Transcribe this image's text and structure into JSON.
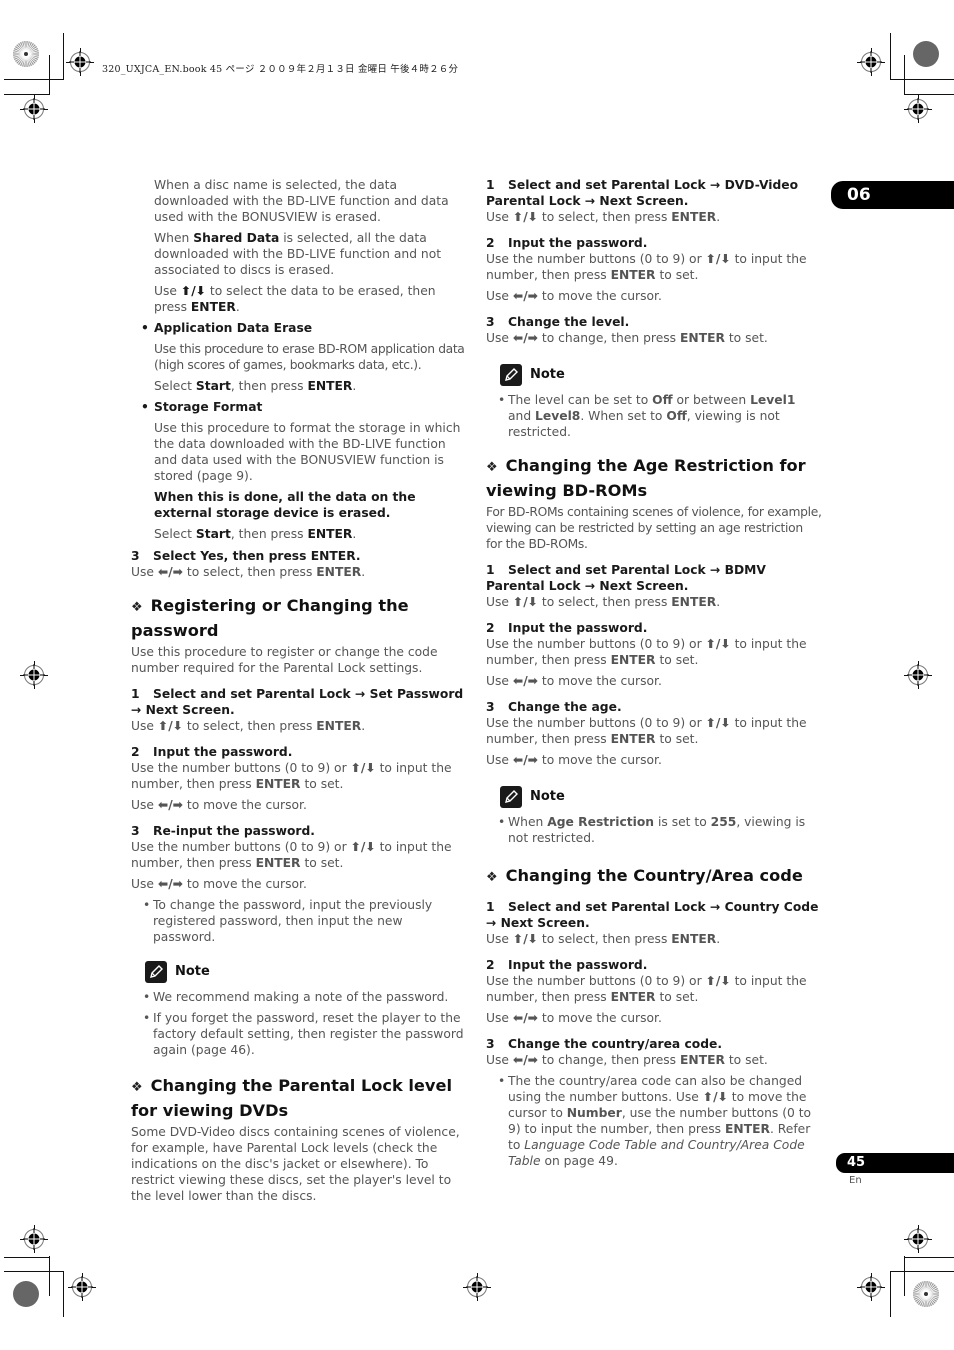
{
  "header": {
    "file_info": "320_UXJCA_EN.book  45 ページ  ２００９年２月１３日  金曜日  午後４時２６分"
  },
  "chapter_tab": "06",
  "footer": {
    "page_number": "45",
    "language": "En"
  },
  "left_column": {
    "intro_paragraphs": [
      [
        {
          "t": "When a disc name is selected, the data downloaded with the BD-LIVE function and data used with the BONUSVIEW is erased."
        }
      ],
      [
        {
          "t": "When "
        },
        {
          "t": "Shared Data",
          "b": true
        },
        {
          "t": " is selected, all the data downloaded with the BD-LIVE function and not associated to discs is erased."
        }
      ],
      [
        {
          "t": "Use "
        },
        {
          "t": "⬆/⬇",
          "b": true
        },
        {
          "t": " to select the data to be erased, then press "
        },
        {
          "t": "ENTER",
          "b": true
        },
        {
          "t": "."
        }
      ]
    ],
    "app_data_erase": {
      "title": "Application Data Erase",
      "desc": "Use this procedure to erase BD-ROM application data (high scores of games, bookmarks data, etc.).",
      "select": [
        {
          "t": "Select "
        },
        {
          "t": "Start",
          "b": true
        },
        {
          "t": ", then press "
        },
        {
          "t": "ENTER",
          "b": true
        },
        {
          "t": "."
        }
      ]
    },
    "storage_format": {
      "title": "Storage Format",
      "desc": "Use this procedure to format the storage in which the data downloaded with the BD-LIVE function and data used with the BONUSVIEW function is stored (page 9).",
      "warning": "When this is done, all the data on the external storage device is erased.",
      "select": [
        {
          "t": "Select "
        },
        {
          "t": "Start",
          "b": true
        },
        {
          "t": ", then press "
        },
        {
          "t": "ENTER",
          "b": true
        },
        {
          "t": "."
        }
      ]
    },
    "step3_yes": {
      "num": "3",
      "title": "Select Yes, then press ENTER.",
      "body": [
        {
          "t": "Use "
        },
        {
          "t": "⬅/➡",
          "b": true
        },
        {
          "t": " to select, then press "
        },
        {
          "t": "ENTER",
          "b": true
        },
        {
          "t": "."
        }
      ]
    },
    "password_section": {
      "heading": "Registering or Changing the password",
      "intro": "Use this procedure to register or change the code number required for the Parental Lock settings.",
      "steps": [
        {
          "num": "1",
          "title": "Select and set Parental Lock → Set Password → Next Screen.",
          "body": [
            [
              {
                "t": "Use "
              },
              {
                "t": "⬆/⬇",
                "b": true
              },
              {
                "t": " to select, then press "
              },
              {
                "t": "ENTER",
                "b": true
              },
              {
                "t": "."
              }
            ]
          ]
        },
        {
          "num": "2",
          "title": "Input the password.",
          "body": [
            [
              {
                "t": "Use the number buttons (0 to 9) or "
              },
              {
                "t": "⬆/⬇",
                "b": true
              },
              {
                "t": " to input the number, then press "
              },
              {
                "t": "ENTER",
                "b": true
              },
              {
                "t": " to set."
              }
            ],
            [
              {
                "t": "Use "
              },
              {
                "t": "⬅/➡",
                "b": true
              },
              {
                "t": " to move the cursor."
              }
            ]
          ]
        },
        {
          "num": "3",
          "title": "Re-input the password.",
          "body": [
            [
              {
                "t": "Use the number buttons (0 to 9) or "
              },
              {
                "t": "⬆/⬇",
                "b": true
              },
              {
                "t": " to input the number, then press "
              },
              {
                "t": "ENTER",
                "b": true
              },
              {
                "t": " to set."
              }
            ],
            [
              {
                "t": "Use "
              },
              {
                "t": "⬅/➡",
                "b": true
              },
              {
                "t": " to move the cursor."
              }
            ]
          ],
          "bullets": [
            "To change the password, input the previously registered password, then input the new password."
          ]
        }
      ],
      "note_label": "Note",
      "notes": [
        "We recommend making a note of the password.",
        "If you forget the password, reset the player to the factory default setting, then register the password again (page 46)."
      ]
    },
    "dvd_section": {
      "heading": "Changing the Parental Lock level for viewing DVDs",
      "intro": "Some DVD-Video discs containing scenes of violence, for example, have Parental Lock levels (check the indications on the disc's jacket or elsewhere). To restrict viewing these discs, set the player's level to the level lower than the discs."
    }
  },
  "right_column": {
    "dvd_steps": [
      {
        "num": "1",
        "title": "Select and set Parental Lock → DVD-Video Parental Lock → Next Screen.",
        "body": [
          [
            {
              "t": "Use "
            },
            {
              "t": "⬆/⬇",
              "b": true
            },
            {
              "t": " to select, then press "
            },
            {
              "t": "ENTER",
              "b": true
            },
            {
              "t": "."
            }
          ]
        ]
      },
      {
        "num": "2",
        "title": "Input the password.",
        "body": [
          [
            {
              "t": "Use the number buttons (0 to 9) or "
            },
            {
              "t": "⬆/⬇",
              "b": true
            },
            {
              "t": " to input the number, then press "
            },
            {
              "t": "ENTER",
              "b": true
            },
            {
              "t": " to set."
            }
          ],
          [
            {
              "t": "Use "
            },
            {
              "t": "⬅/➡",
              "b": true
            },
            {
              "t": " to move the cursor."
            }
          ]
        ]
      },
      {
        "num": "3",
        "title": "Change the level.",
        "body": [
          [
            {
              "t": "Use "
            },
            {
              "t": "⬅/➡",
              "b": true
            },
            {
              "t": " to change, then press "
            },
            {
              "t": "ENTER",
              "b": true
            },
            {
              "t": " to set."
            }
          ]
        ]
      }
    ],
    "dvd_note": {
      "label": "Note",
      "bullets": [
        [
          {
            "t": "The level can be set to "
          },
          {
            "t": "Off",
            "b": true
          },
          {
            "t": " or between "
          },
          {
            "t": "Level1",
            "b": true
          },
          {
            "t": " and "
          },
          {
            "t": "Level8",
            "b": true
          },
          {
            "t": ". When set to "
          },
          {
            "t": "Off",
            "b": true
          },
          {
            "t": ", viewing is not restricted."
          }
        ]
      ]
    },
    "age_section": {
      "heading": "Changing the Age Restriction for viewing BD-ROMs",
      "intro": "For BD-ROMs containing scenes of violence, for example, viewing can be restricted by setting an age restriction for the BD-ROMs.",
      "steps": [
        {
          "num": "1",
          "title": "Select and set Parental Lock → BDMV Parental Lock → Next Screen.",
          "body": [
            [
              {
                "t": "Use "
              },
              {
                "t": "⬆/⬇",
                "b": true
              },
              {
                "t": " to select, then press "
              },
              {
                "t": "ENTER",
                "b": true
              },
              {
                "t": "."
              }
            ]
          ]
        },
        {
          "num": "2",
          "title": "Input the password.",
          "body": [
            [
              {
                "t": "Use the number buttons (0 to 9) or "
              },
              {
                "t": "⬆/⬇",
                "b": true
              },
              {
                "t": " to input the number, then press "
              },
              {
                "t": "ENTER",
                "b": true
              },
              {
                "t": " to set."
              }
            ],
            [
              {
                "t": "Use "
              },
              {
                "t": "⬅/➡",
                "b": true
              },
              {
                "t": " to move the cursor."
              }
            ]
          ]
        },
        {
          "num": "3",
          "title": "Change the age.",
          "body": [
            [
              {
                "t": "Use the number buttons (0 to 9) or "
              },
              {
                "t": "⬆/⬇",
                "b": true
              },
              {
                "t": " to input the number, then press "
              },
              {
                "t": "ENTER",
                "b": true
              },
              {
                "t": " to set."
              }
            ],
            [
              {
                "t": "Use "
              },
              {
                "t": "⬅/➡",
                "b": true
              },
              {
                "t": " to move the cursor."
              }
            ]
          ]
        }
      ],
      "note_label": "Note",
      "notes": [
        [
          {
            "t": "When "
          },
          {
            "t": "Age Restriction",
            "b": true
          },
          {
            "t": " is set to "
          },
          {
            "t": "255",
            "b": true
          },
          {
            "t": ", viewing is not restricted."
          }
        ]
      ]
    },
    "country_section": {
      "heading": "Changing the Country/Area code",
      "steps": [
        {
          "num": "1",
          "title": "Select and set Parental Lock → Country Code → Next Screen.",
          "body": [
            [
              {
                "t": "Use "
              },
              {
                "t": "⬆/⬇",
                "b": true
              },
              {
                "t": " to select, then press "
              },
              {
                "t": "ENTER",
                "b": true
              },
              {
                "t": "."
              }
            ]
          ]
        },
        {
          "num": "2",
          "title": "Input the password.",
          "body": [
            [
              {
                "t": "Use the number buttons (0 to 9) or "
              },
              {
                "t": "⬆/⬇",
                "b": true
              },
              {
                "t": " to input the number, then press "
              },
              {
                "t": "ENTER",
                "b": true
              },
              {
                "t": " to set."
              }
            ],
            [
              {
                "t": "Use "
              },
              {
                "t": "⬅/➡",
                "b": true
              },
              {
                "t": " to move the cursor."
              }
            ]
          ]
        },
        {
          "num": "3",
          "title": "Change the country/area code.",
          "body": [
            [
              {
                "t": "Use "
              },
              {
                "t": "⬅/➡",
                "b": true
              },
              {
                "t": " to change, then press "
              },
              {
                "t": "ENTER",
                "b": true
              },
              {
                "t": " to set."
              }
            ]
          ],
          "bullets": [
            [
              {
                "t": "The the country/area code can also be changed using the number buttons. Use "
              },
              {
                "t": "⬆/⬇",
                "b": true
              },
              {
                "t": " to move the cursor to "
              },
              {
                "t": "Number",
                "b": true
              },
              {
                "t": ", use the number buttons (0 to 9) to input the number, then press "
              },
              {
                "t": "ENTER",
                "b": true
              },
              {
                "t": ". Refer to "
              },
              {
                "t": "Language Code Table and Country/Area Code Table",
                "i": true
              },
              {
                "t": " on page 49."
              }
            ]
          ]
        }
      ]
    }
  }
}
